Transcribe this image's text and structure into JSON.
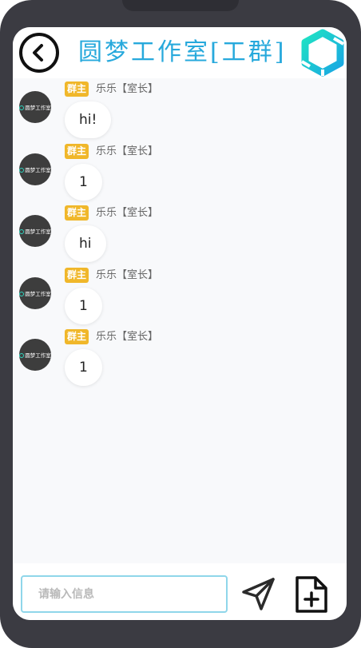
{
  "header": {
    "title": "圆梦工作室[工群]",
    "back_icon": "chevron-left-circle-icon",
    "logo_icon": "hexagon-logo-icon"
  },
  "avatar_text": "圆梦工作室",
  "messages": [
    {
      "badge": "群主",
      "sender": "乐乐【室长】",
      "text": "hi!"
    },
    {
      "badge": "群主",
      "sender": "乐乐【室长】",
      "text": "1"
    },
    {
      "badge": "群主",
      "sender": "乐乐【室长】",
      "text": "hi"
    },
    {
      "badge": "群主",
      "sender": "乐乐【室长】",
      "text": "1"
    },
    {
      "badge": "群主",
      "sender": "乐乐【室长】",
      "text": "1"
    }
  ],
  "input": {
    "placeholder": "请输入信息",
    "value": ""
  },
  "actions": {
    "send_icon": "send-icon",
    "file_icon": "file-add-icon"
  },
  "colors": {
    "accent": "#27a9dc",
    "badge": "#f0b72a",
    "logo_teal": "#1fe3c3",
    "logo_blue": "#1aa6e4"
  }
}
